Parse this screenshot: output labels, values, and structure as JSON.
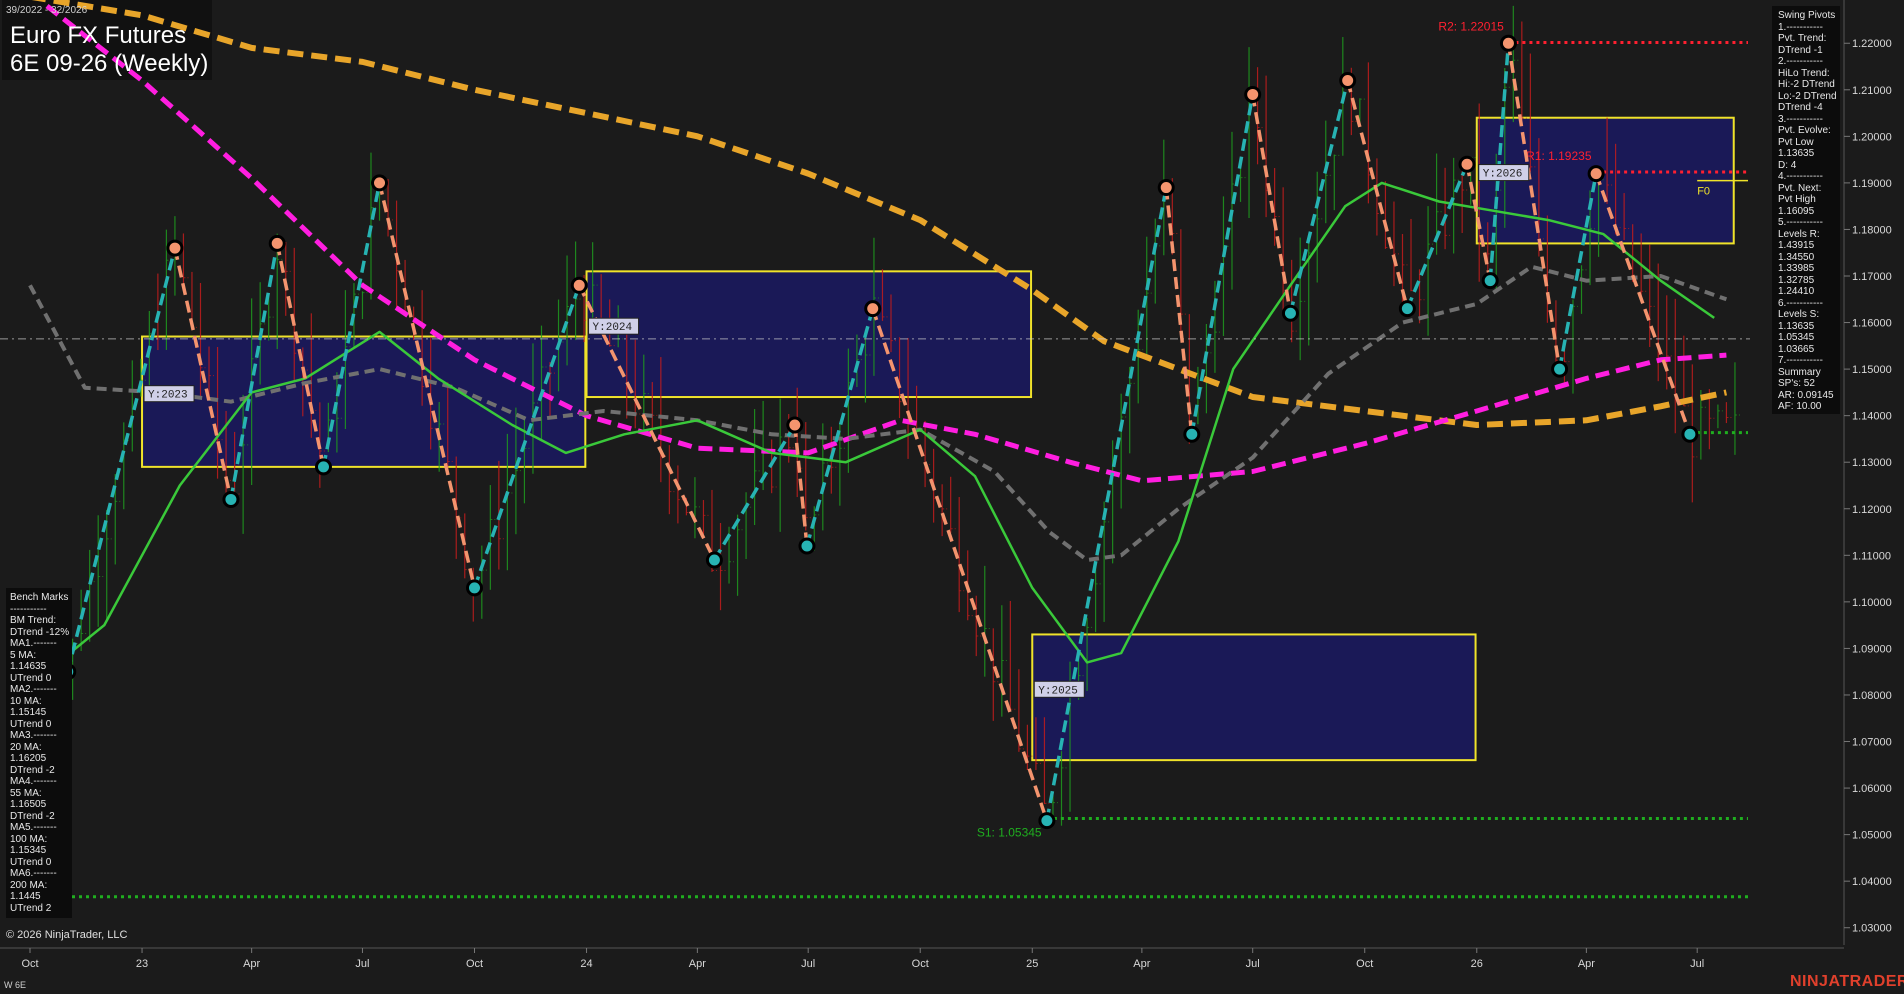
{
  "header": {
    "date_range": "39/2022 - 32/2026",
    "title": "Euro FX Futures",
    "subtitle": "6E 09-26 (Weekly)"
  },
  "swing_pivots_panel": {
    "lines": [
      "Swing Pivots",
      "1.-----------",
      "Pvt. Trend:",
      "DTrend -1",
      "2.-----------",
      "HiLo Trend:",
      "Hi:-2 DTrend",
      "Lo:-2 DTrend",
      "DTrend -4",
      "3.-----------",
      "Pvt. Evolve:",
      "Pvt Low",
      "1.13635",
      "D: 4",
      "4.-----------",
      "Pvt. Next:",
      "Pvt High",
      "1.16095",
      "5.-----------",
      "Levels R:",
      "1.43915",
      "1.34550",
      "1.33985",
      "1.32785",
      "1.24410",
      "6.-----------",
      "Levels S:",
      "1.13635",
      "1.05345",
      "1.03665",
      "7.-----------",
      "Summary",
      "SP's: 52",
      "AR: 0.09145",
      "AF: 10.00"
    ]
  },
  "benchmarks_panel": {
    "lines": [
      "Bench Marks",
      "-----------",
      "BM Trend:",
      "DTrend -12%",
      "MA1.-------",
      "5 MA:",
      "1.14635",
      "UTrend 0",
      "MA2.-------",
      "10 MA:",
      "1.15145",
      "UTrend 0",
      "MA3.-------",
      "20 MA:",
      "1.16205",
      "DTrend -2",
      "MA4.-------",
      "55 MA:",
      "1.16505",
      "DTrend -2",
      "MA5.-------",
      "100 MA:",
      "1.15345",
      "UTrend 0",
      "MA6.-------",
      "200 MA:",
      "1.1445",
      "UTrend 2"
    ]
  },
  "footer": {
    "copyright": "© 2026 NinjaTrader, LLC",
    "left_tag": "W 6E",
    "brand": "NINJATRADER"
  },
  "colors": {
    "background": "#1b1b1b",
    "up_bar": "#1f9a1f",
    "down_bar": "#c21c1c",
    "pivot_high_leg": "#f4946e",
    "pivot_low_leg": "#27b3b3",
    "ma_green": "#3ac93a",
    "ma_gray": "#707070",
    "ma_magenta": "#ff1ee0",
    "ma_orange": "#e8a52a",
    "year_box_fill": "#1b1a5e",
    "year_box_border": "#f0e32a",
    "resistance": "#ff2030",
    "support": "#1fae1f",
    "price_line": "#cfcfcf"
  },
  "chart_data": {
    "type": "candlestick",
    "title": "6E 09-26 (Weekly)",
    "ylim": [
      1.025,
      1.228
    ],
    "y_ticks": [
      "1.03000",
      "1.04000",
      "1.05000",
      "1.06000",
      "1.07000",
      "1.08000",
      "1.09000",
      "1.10000",
      "1.11000",
      "1.12000",
      "1.13000",
      "1.14000",
      "1.15000",
      "1.16000",
      "1.17000",
      "1.18000",
      "1.19000",
      "1.20000",
      "1.21000",
      "1.22000"
    ],
    "x_range": [
      "2022-10-01",
      "2026-08-15"
    ],
    "x_ticks": [
      {
        "date": "2022-10-01",
        "label": "Oct"
      },
      {
        "date": "2023-01-01",
        "label": "23"
      },
      {
        "date": "2023-04-01",
        "label": "Apr"
      },
      {
        "date": "2023-07-01",
        "label": "Jul"
      },
      {
        "date": "2023-10-01",
        "label": "Oct"
      },
      {
        "date": "2024-01-01",
        "label": "24"
      },
      {
        "date": "2024-04-01",
        "label": "Apr"
      },
      {
        "date": "2024-07-01",
        "label": "Jul"
      },
      {
        "date": "2024-10-01",
        "label": "Oct"
      },
      {
        "date": "2025-01-01",
        "label": "25"
      },
      {
        "date": "2025-04-01",
        "label": "Apr"
      },
      {
        "date": "2025-07-01",
        "label": "Jul"
      },
      {
        "date": "2025-10-01",
        "label": "Oct"
      },
      {
        "date": "2026-01-01",
        "label": "26"
      },
      {
        "date": "2026-04-01",
        "label": "Apr"
      },
      {
        "date": "2026-07-01",
        "label": "Jul"
      }
    ],
    "swing_pivots": [
      {
        "date": "2022-11-01",
        "price": 1.085,
        "type": "low"
      },
      {
        "date": "2023-01-28",
        "price": 1.176,
        "type": "high"
      },
      {
        "date": "2023-03-15",
        "price": 1.122,
        "type": "low"
      },
      {
        "date": "2023-04-22",
        "price": 1.177,
        "type": "high"
      },
      {
        "date": "2023-05-30",
        "price": 1.129,
        "type": "low"
      },
      {
        "date": "2023-07-15",
        "price": 1.19,
        "type": "high"
      },
      {
        "date": "2023-10-01",
        "price": 1.103,
        "type": "low"
      },
      {
        "date": "2023-12-26",
        "price": 1.168,
        "type": "high"
      },
      {
        "date": "2024-04-15",
        "price": 1.109,
        "type": "low"
      },
      {
        "date": "2024-08-23",
        "price": 1.163,
        "type": "high"
      },
      {
        "date": "2024-06-20",
        "price": 1.138,
        "type": "high"
      },
      {
        "date": "2024-06-30",
        "price": 1.112,
        "type": "low"
      },
      {
        "date": "2025-01-13",
        "price": 1.053,
        "type": "low"
      },
      {
        "date": "2025-04-21",
        "price": 1.189,
        "type": "high"
      },
      {
        "date": "2025-05-12",
        "price": 1.136,
        "type": "low"
      },
      {
        "date": "2025-07-01",
        "price": 1.209,
        "type": "high"
      },
      {
        "date": "2025-08-01",
        "price": 1.162,
        "type": "low"
      },
      {
        "date": "2025-09-17",
        "price": 1.212,
        "type": "high"
      },
      {
        "date": "2025-11-05",
        "price": 1.163,
        "type": "low"
      },
      {
        "date": "2025-12-24",
        "price": 1.194,
        "type": "high"
      },
      {
        "date": "2026-01-12",
        "price": 1.169,
        "type": "low"
      },
      {
        "date": "2026-01-27",
        "price": 1.22,
        "type": "high"
      },
      {
        "date": "2026-03-10",
        "price": 1.15,
        "type": "low"
      },
      {
        "date": "2026-04-09",
        "price": 1.192,
        "type": "high"
      },
      {
        "date": "2026-06-25",
        "price": 1.136,
        "type": "low"
      }
    ],
    "year_boxes": [
      {
        "label": "Y:2023",
        "start": "2023-01-01",
        "end": "2023-12-31",
        "low": 1.129,
        "high": 1.157
      },
      {
        "label": "Y:2024",
        "start": "2024-01-01",
        "end": "2024-12-31",
        "low": 1.144,
        "high": 1.171
      },
      {
        "label": "Y:2025",
        "start": "2025-01-01",
        "end": "2025-12-31",
        "low": 1.066,
        "high": 1.093
      },
      {
        "label": "Y:2026",
        "start": "2026-01-01",
        "end": "2026-07-31",
        "low": 1.177,
        "high": 1.204
      }
    ],
    "levels": [
      {
        "label": "R2: 1.22015",
        "price": 1.22015,
        "start": "2026-01-27",
        "kind": "resistance"
      },
      {
        "label": "R1: 1.19235",
        "price": 1.19235,
        "start": "2026-04-09",
        "kind": "resistance"
      },
      {
        "label": "S1: 1.05345",
        "price": 1.05345,
        "start": "2025-01-13",
        "kind": "support"
      },
      {
        "label": "",
        "price": 1.03665,
        "start": "2022-10-01",
        "kind": "support"
      },
      {
        "label": "",
        "price": 1.13635,
        "start": "2026-06-25",
        "kind": "support"
      }
    ],
    "f0_marker": {
      "label": "F0",
      "price": 1.1905,
      "start": "2026-07-01"
    },
    "current_price": 1.1565,
    "moving_averages": {
      "ma_green": [
        [
          "2022-10-15",
          1.085
        ],
        [
          "2022-12-01",
          1.095
        ],
        [
          "2023-02-01",
          1.125
        ],
        [
          "2023-04-01",
          1.145
        ],
        [
          "2023-05-15",
          1.148
        ],
        [
          "2023-07-15",
          1.158
        ],
        [
          "2023-09-01",
          1.148
        ],
        [
          "2023-11-01",
          1.138
        ],
        [
          "2023-12-15",
          1.132
        ],
        [
          "2024-02-01",
          1.136
        ],
        [
          "2024-04-01",
          1.139
        ],
        [
          "2024-06-01",
          1.132
        ],
        [
          "2024-08-01",
          1.13
        ],
        [
          "2024-10-01",
          1.137
        ],
        [
          "2024-11-15",
          1.127
        ],
        [
          "2025-01-01",
          1.103
        ],
        [
          "2025-02-15",
          1.087
        ],
        [
          "2025-03-15",
          1.089
        ],
        [
          "2025-05-01",
          1.113
        ],
        [
          "2025-06-15",
          1.15
        ],
        [
          "2025-08-01",
          1.168
        ],
        [
          "2025-09-15",
          1.185
        ],
        [
          "2025-10-15",
          1.19
        ],
        [
          "2025-12-01",
          1.186
        ],
        [
          "2026-01-15",
          1.184
        ],
        [
          "2026-03-01",
          1.182
        ],
        [
          "2026-04-15",
          1.179
        ],
        [
          "2026-06-01",
          1.169
        ],
        [
          "2026-07-15",
          1.161
        ]
      ],
      "ma_gray": [
        [
          "2022-10-01",
          1.168
        ],
        [
          "2022-11-15",
          1.146
        ],
        [
          "2023-01-15",
          1.145
        ],
        [
          "2023-03-15",
          1.143
        ],
        [
          "2023-05-15",
          1.147
        ],
        [
          "2023-07-15",
          1.15
        ],
        [
          "2023-09-15",
          1.146
        ],
        [
          "2023-11-15",
          1.139
        ],
        [
          "2024-01-15",
          1.141
        ],
        [
          "2024-04-01",
          1.139
        ],
        [
          "2024-06-01",
          1.136
        ],
        [
          "2024-08-01",
          1.135
        ],
        [
          "2024-10-01",
          1.137
        ],
        [
          "2024-12-01",
          1.128
        ],
        [
          "2025-01-15",
          1.115
        ],
        [
          "2025-02-15",
          1.109
        ],
        [
          "2025-03-15",
          1.11
        ],
        [
          "2025-05-01",
          1.12
        ],
        [
          "2025-07-01",
          1.131
        ],
        [
          "2025-09-01",
          1.149
        ],
        [
          "2025-11-01",
          1.16
        ],
        [
          "2026-01-01",
          1.164
        ],
        [
          "2026-02-15",
          1.172
        ],
        [
          "2026-04-01",
          1.169
        ],
        [
          "2026-06-01",
          1.17
        ],
        [
          "2026-07-25",
          1.165
        ]
      ],
      "ma_magenta": [
        [
          "2022-10-15",
          1.228
        ],
        [
          "2023-01-01",
          1.212
        ],
        [
          "2023-04-01",
          1.191
        ],
        [
          "2023-07-01",
          1.168
        ],
        [
          "2023-10-01",
          1.152
        ],
        [
          "2024-01-01",
          1.14
        ],
        [
          "2024-04-01",
          1.133
        ],
        [
          "2024-07-01",
          1.132
        ],
        [
          "2024-09-15",
          1.139
        ],
        [
          "2024-11-15",
          1.136
        ],
        [
          "2025-02-01",
          1.13
        ],
        [
          "2025-04-01",
          1.126
        ],
        [
          "2025-07-01",
          1.128
        ],
        [
          "2025-10-01",
          1.134
        ],
        [
          "2026-01-01",
          1.141
        ],
        [
          "2026-04-01",
          1.148
        ],
        [
          "2026-06-01",
          1.152
        ],
        [
          "2026-07-25",
          1.153
        ]
      ],
      "ma_orange": [
        [
          "2022-10-01",
          1.23
        ],
        [
          "2023-01-01",
          1.226
        ],
        [
          "2023-04-01",
          1.219
        ],
        [
          "2023-07-01",
          1.216
        ],
        [
          "2023-10-01",
          1.21
        ],
        [
          "2024-01-01",
          1.205
        ],
        [
          "2024-04-01",
          1.2
        ],
        [
          "2024-07-01",
          1.192
        ],
        [
          "2024-10-01",
          1.182
        ],
        [
          "2025-01-01",
          1.167
        ],
        [
          "2025-03-01",
          1.156
        ],
        [
          "2025-05-01",
          1.15
        ],
        [
          "2025-07-01",
          1.144
        ],
        [
          "2025-10-01",
          1.141
        ],
        [
          "2026-01-01",
          1.138
        ],
        [
          "2026-04-01",
          1.139
        ],
        [
          "2026-06-01",
          1.142
        ],
        [
          "2026-07-25",
          1.145
        ]
      ]
    }
  }
}
